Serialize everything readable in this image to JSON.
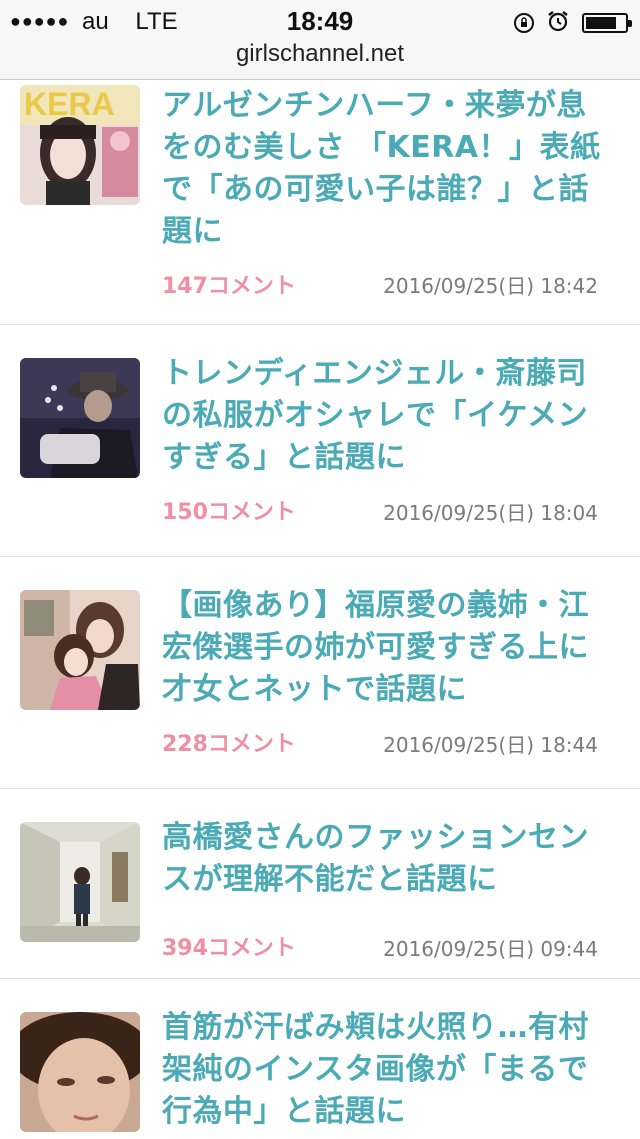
{
  "status_bar": {
    "signal": "●●●●●",
    "carrier": "au",
    "network": "LTE",
    "time": "18:49",
    "url": "girlschannel.net"
  },
  "articles": [
    {
      "title": "アルゼンチンハーフ・来夢が息をのむ美しさ 「KERA！」表紙で「あの可愛い子は誰？」と話題に",
      "comments": "147コメント",
      "date": "2016/09/25(日) 18:42",
      "thumbnail": "kera-magazine-cover"
    },
    {
      "title": "トレンディエンジェル・斎藤司の私服がオシャレで「イケメンすぎる」と話題に",
      "comments": "150コメント",
      "date": "2016/09/25(日) 18:04",
      "thumbnail": "selfie-hat-photo"
    },
    {
      "title": "【画像あり】福原愛の義姉・江宏傑選手の姉が可愛すぎる上に才女とネットで話題に",
      "comments": "228コメント",
      "date": "2016/09/25(日) 18:44",
      "thumbnail": "two-women-photo"
    },
    {
      "title": "高橋愛さんのファッションセンスが理解不能だと話題に",
      "comments": "394コメント",
      "date": "2016/09/25(日) 09:44",
      "thumbnail": "hallway-fashion-photo"
    },
    {
      "title": "首筋が汗ばみ頬は火照り…有村架純のインスタ画像が「まるで行為中」と話題に",
      "comments": "",
      "date": "",
      "thumbnail": "face-closeup-photo"
    }
  ]
}
